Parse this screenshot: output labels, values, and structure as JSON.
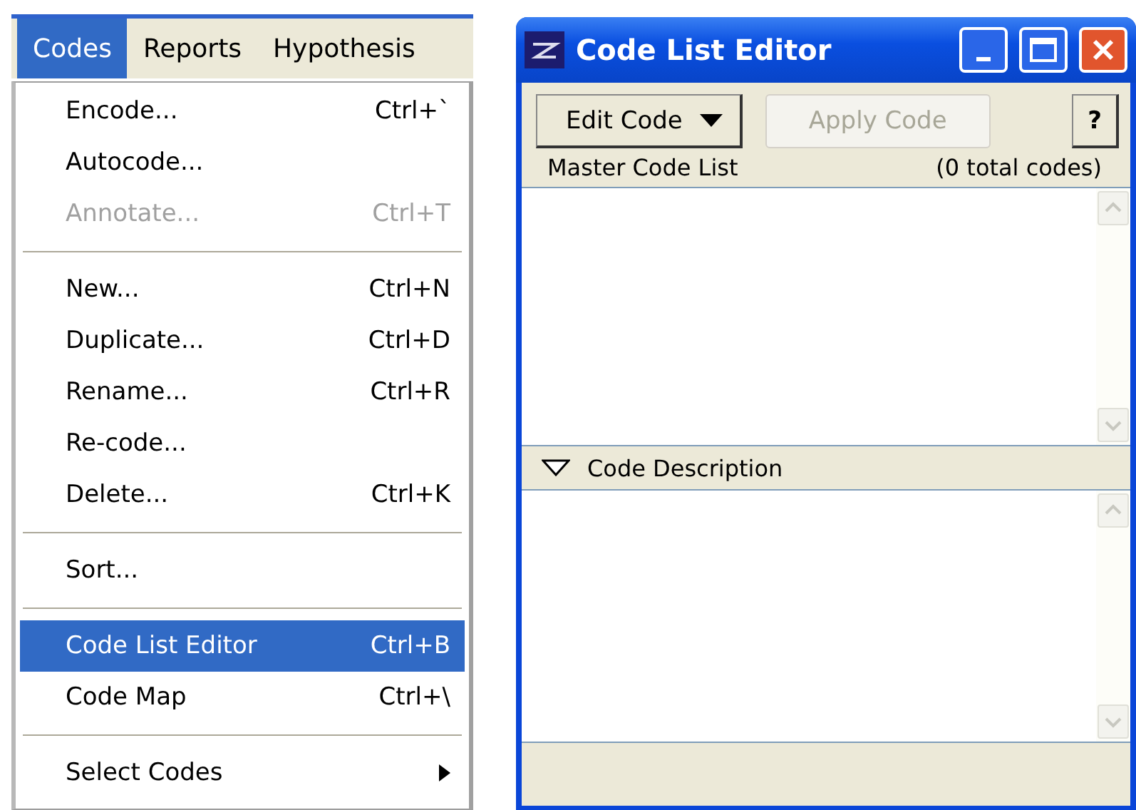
{
  "menu_bar": {
    "items": [
      {
        "label": "Codes",
        "selected": true
      },
      {
        "label": "Reports",
        "selected": false
      },
      {
        "label": "Hypothesis",
        "selected": false
      }
    ]
  },
  "menu": {
    "groups": [
      {
        "items": [
          {
            "label": "Encode...",
            "shortcut": "Ctrl+`",
            "disabled": false,
            "selected": false
          },
          {
            "label": "Autocode...",
            "disabled": false,
            "selected": false
          },
          {
            "label": "Annotate...",
            "shortcut": "Ctrl+T",
            "disabled": true,
            "selected": false
          }
        ]
      },
      {
        "items": [
          {
            "label": "New...",
            "shortcut": "Ctrl+N",
            "disabled": false,
            "selected": false
          },
          {
            "label": "Duplicate...",
            "shortcut": "Ctrl+D",
            "disabled": false,
            "selected": false
          },
          {
            "label": "Rename...",
            "shortcut": "Ctrl+R",
            "disabled": false,
            "selected": false
          },
          {
            "label": "Re-code...",
            "disabled": false,
            "selected": false
          },
          {
            "label": "Delete...",
            "shortcut": "Ctrl+K",
            "disabled": false,
            "selected": false
          }
        ]
      },
      {
        "items": [
          {
            "label": "Sort...",
            "disabled": false,
            "selected": false
          }
        ]
      },
      {
        "items": [
          {
            "label": "Code List Editor",
            "shortcut": "Ctrl+B",
            "disabled": false,
            "selected": true
          },
          {
            "label": "Code Map",
            "shortcut": "Ctrl+\\",
            "disabled": false,
            "selected": false
          }
        ]
      },
      {
        "items": [
          {
            "label": "Select Codes",
            "submenu": true,
            "disabled": false,
            "selected": false
          }
        ]
      }
    ]
  },
  "window": {
    "title": "Code List Editor",
    "toolbar": {
      "edit_button": "Edit Code",
      "apply_button": {
        "label": "Apply Code",
        "disabled": true
      },
      "help_button": "?"
    },
    "list_header": {
      "label": "Master Code List",
      "count": "(0 total codes)"
    },
    "description": {
      "label": "Code Description",
      "expanded": true
    }
  }
}
